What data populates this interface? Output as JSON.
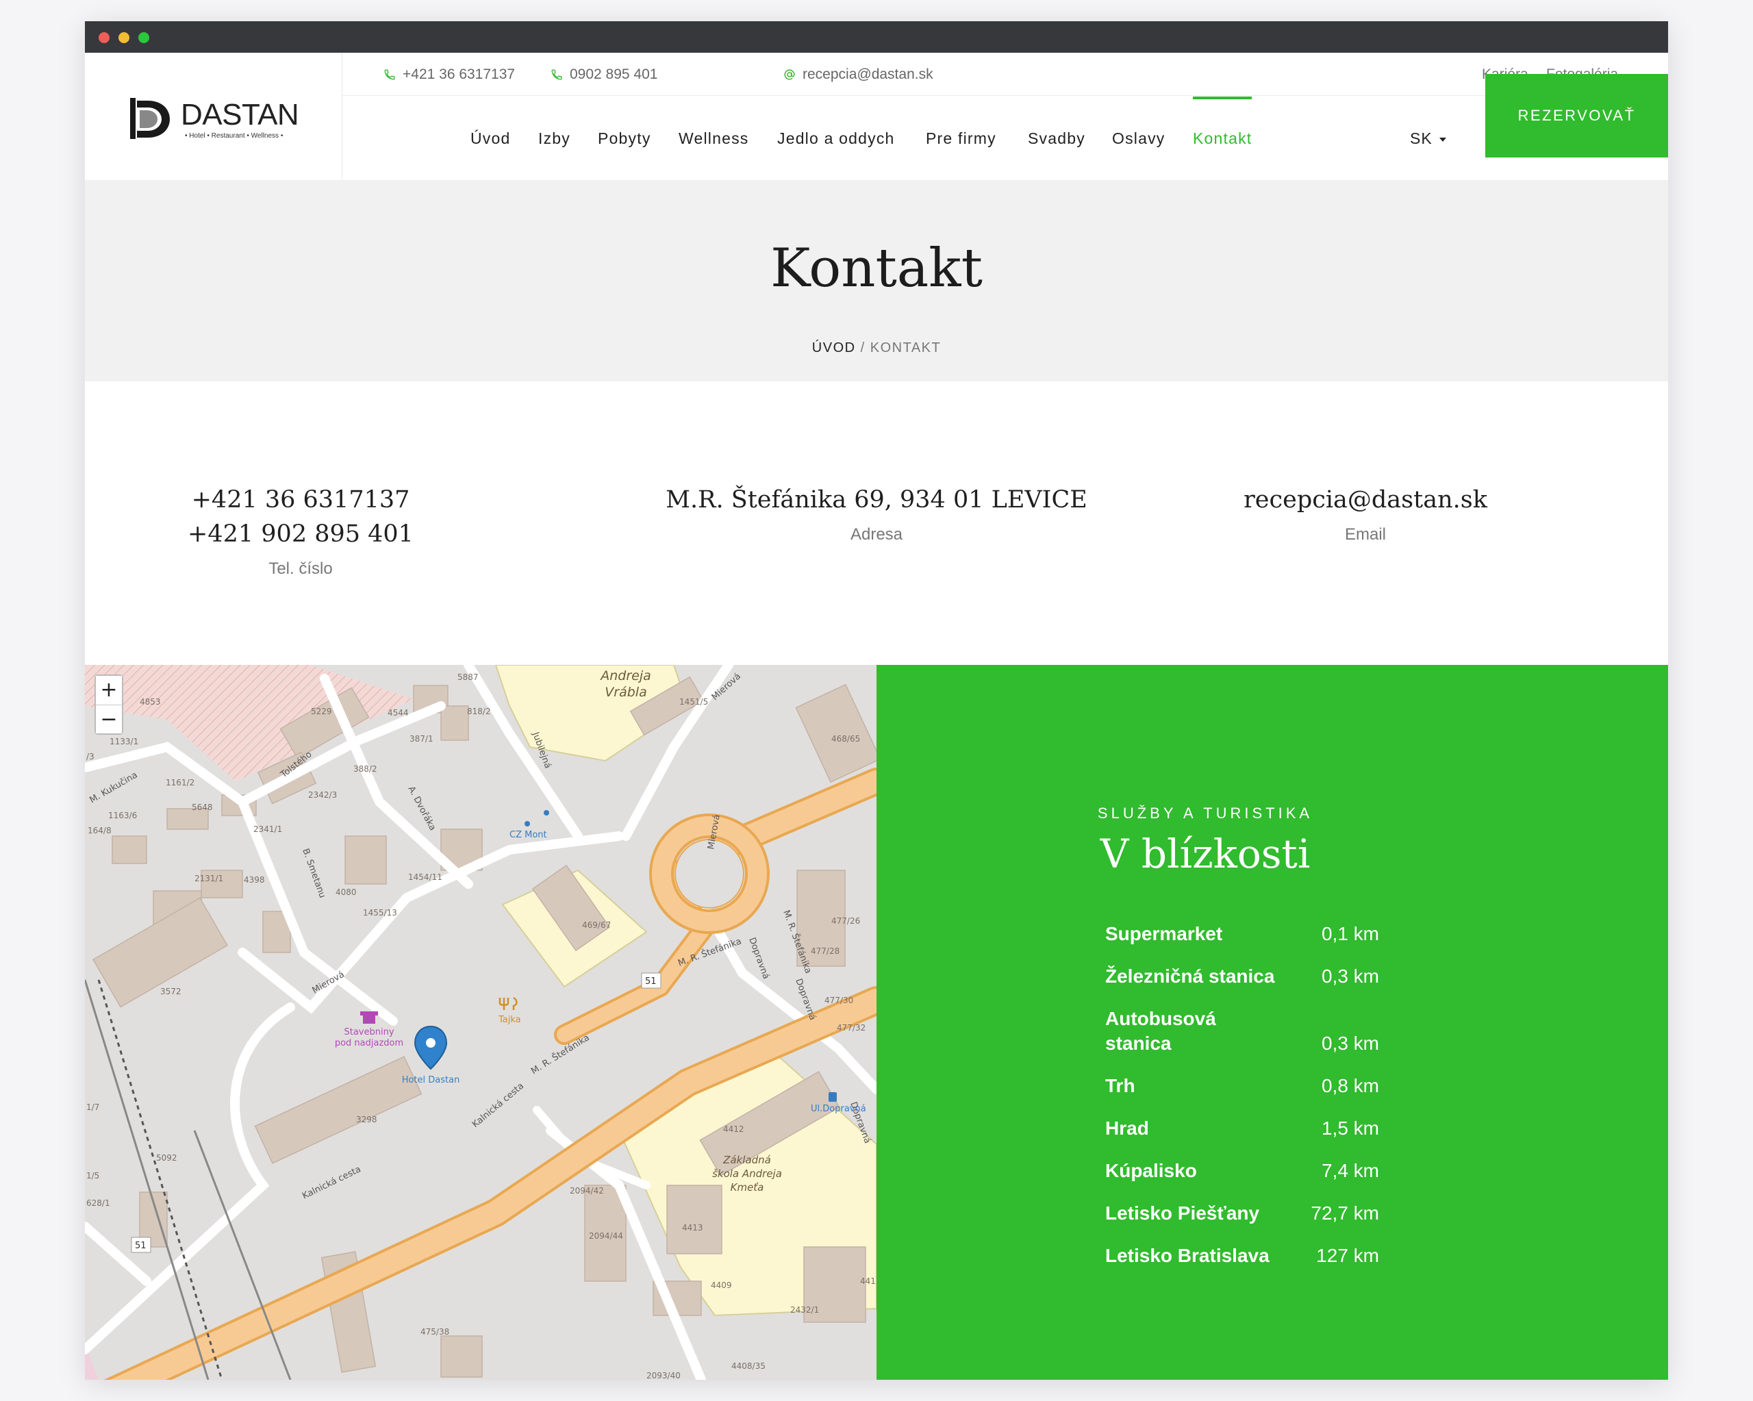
{
  "topbar": {
    "phone1": "+421 36 6317137",
    "phone2": "0902 895 401",
    "email": "recepcia@dastan.sk",
    "links": [
      "Kariéra",
      "Fotogaléria"
    ]
  },
  "logo": {
    "name": "DASTAN",
    "tagline": "• Hotel • Restaurant • Wellness •"
  },
  "nav": {
    "items": [
      "Úvod",
      "Izby",
      "Pobyty",
      "Wellness",
      "Jedlo a oddych",
      "Pre firmy",
      "Svadby",
      "Oslavy",
      "Kontakt"
    ],
    "active": "Kontakt",
    "language": "SK",
    "book_label": "REZERVOVAŤ"
  },
  "hero": {
    "title": "Kontakt",
    "crumb_home": "ÚVOD",
    "crumb_sep": " / ",
    "crumb_current": "KONTAKT"
  },
  "contacts": {
    "phone_line1": "+421 36 6317137",
    "phone_line2": "+421 902 895 401",
    "phone_label": "Tel. číslo",
    "address": "M.R. Štefánika 69, 934 01 LEVICE",
    "address_label": "Adresa",
    "email": "recepcia@dastan.sk",
    "email_label": "Email"
  },
  "map": {
    "zoom_in": "+",
    "zoom_out": "−",
    "labels": {
      "school_top": [
        "Andreja",
        "Vrábla"
      ],
      "mierova_top": "Mierová",
      "kukucina": "M. Kukučina",
      "tolsteho": "Tolstého",
      "jubilejna": "Jubilejná",
      "dvoraka": "A. Dvořáka",
      "snetanu": "B. Smetanu",
      "mierova_left": "Mierová",
      "mierova_center": "Mierová",
      "stefanika1": "M. R. Štefánika",
      "stefanika2": "M. R. Štefánika",
      "stefanika3": "M. R. Štefánika",
      "dopravna1": "Dopravná",
      "dopravna2": "Dopravná",
      "dopravna3": "Dopravná",
      "kalnicka": "Kalnická cesta",
      "kalnicka2": "Kalnická cesta",
      "road51a": "51",
      "road51b": "51",
      "cz_mont": "CZ Mont",
      "tajka": "Tajka",
      "hotel": "Hotel Dastan",
      "stavebniny": [
        "Stavebniny",
        "pod nadjazdom"
      ],
      "ul_dopravna": "Ul.Dopravná",
      "zs": [
        "Základná",
        "škola Andreja",
        "Kmeťa"
      ],
      "house_numbers": [
        "5887",
        "4853",
        "5229",
        "4544",
        "818/2",
        "1451/5",
        "468/65",
        "1133/1",
        "387/1",
        "388/2",
        "1161/2",
        "2342/3",
        "1163/6",
        "5648",
        "164/8",
        "2341/1",
        "1454/11",
        "4080",
        "2131/1",
        "4398",
        "1455/13",
        "469/67",
        "477/26",
        "477/28",
        "477/30",
        "477/32",
        "3572",
        "3298",
        "5092",
        "4412",
        "4413",
        "4409",
        "2094/42",
        "2094/44",
        "475/38",
        "2432/1",
        "4408/35",
        "2093/40",
        "441",
        "1/7",
        "1/5",
        "628/1",
        "/3"
      ]
    }
  },
  "nearby": {
    "kicker": "SLUŽBY A TURISTIKA",
    "title": "V blízkosti",
    "items": [
      {
        "name": "Supermarket",
        "dist": "0,1 km"
      },
      {
        "name": "Železničná stanica",
        "dist": "0,3 km"
      },
      {
        "name": "Autobusová stanica",
        "dist": "0,3 km"
      },
      {
        "name": "Trh",
        "dist": "0,8 km"
      },
      {
        "name": "Hrad",
        "dist": "1,5 km"
      },
      {
        "name": "Kúpalisko",
        "dist": "7,4 km"
      },
      {
        "name": "Letisko Piešťany",
        "dist": "72,7 km"
      },
      {
        "name": "Letisko Bratislava",
        "dist": "127 km"
      }
    ]
  },
  "colors": {
    "brand_green": "#31bb2e",
    "titlebar": "#37383c",
    "hero_bg": "#f1f1f1"
  }
}
